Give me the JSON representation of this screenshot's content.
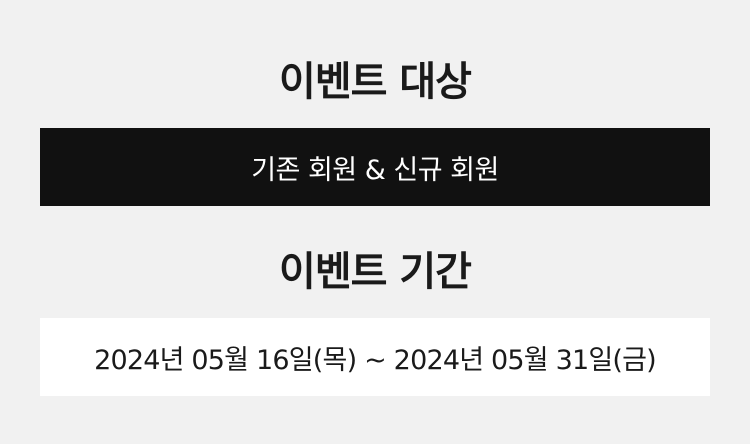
{
  "target_section": {
    "title": "이벤트 대상",
    "value": "기존 회원 & 신규 회원"
  },
  "period_section": {
    "title": "이벤트 기간",
    "value": "2024년 05월 16일(목) ~ 2024년 05월 31일(금)"
  },
  "colors": {
    "background": "#f1f1f1",
    "dark_box": "#111111",
    "light_box": "#ffffff",
    "text_dark": "#1a1a1a",
    "text_light": "#ffffff"
  }
}
